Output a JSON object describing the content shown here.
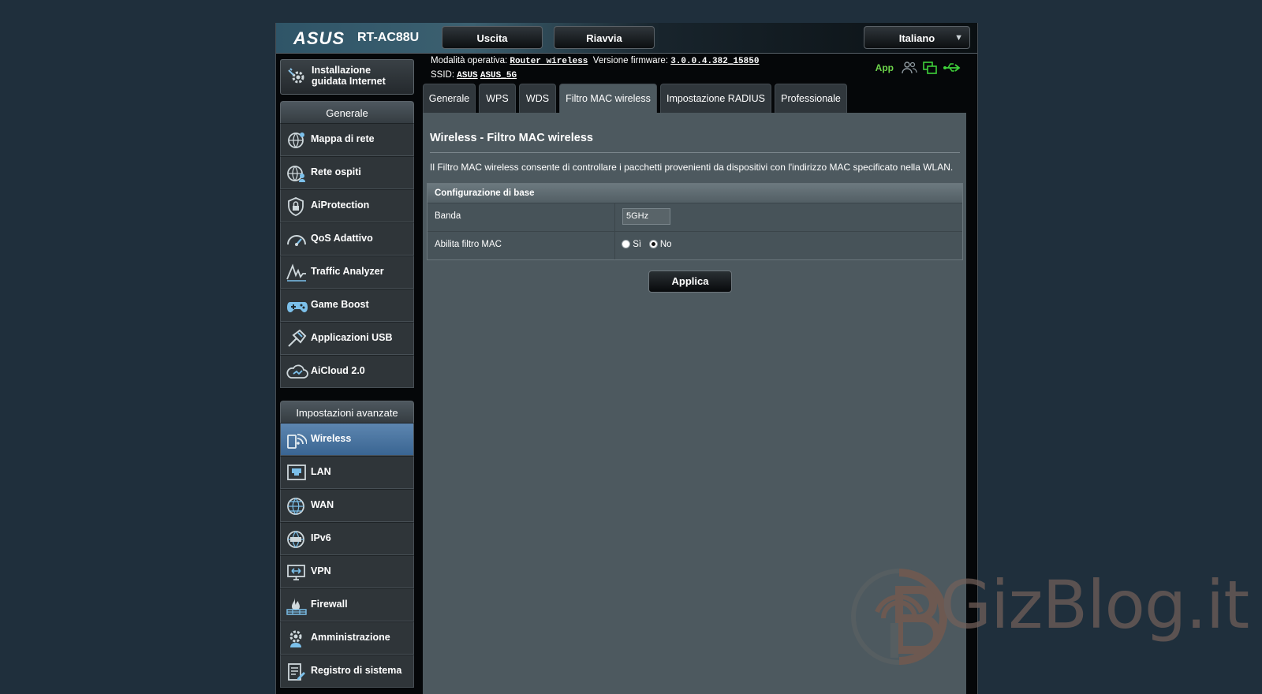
{
  "header": {
    "logo": "ASUS",
    "model": "RT-AC88U",
    "buttons": {
      "logout": "Uscita",
      "reboot": "Riavvia"
    },
    "language": "Italiano"
  },
  "info": {
    "mode_label": "Modalità operativa:",
    "mode_value": "Router wireless",
    "firmware_label": "Versione firmware:",
    "firmware_value": "3.0.0.4.382_15850",
    "ssid_label": "SSID:",
    "ssid_values": [
      "ASUS",
      "ASUS_5G"
    ],
    "app_label": "App"
  },
  "sidebar": {
    "qis_label_line1": "Installazione",
    "qis_label_line2": "guidata Internet",
    "general_header": "Generale",
    "general_items": [
      {
        "label": "Mappa di rete",
        "icon": "network-map-icon"
      },
      {
        "label": "Rete ospiti",
        "icon": "guest-network-icon"
      },
      {
        "label": "AiProtection",
        "icon": "shield-lock-icon"
      },
      {
        "label": "QoS Adattivo",
        "icon": "speedometer-icon"
      },
      {
        "label": "Traffic Analyzer",
        "icon": "traffic-analyzer-icon"
      },
      {
        "label": "Game Boost",
        "icon": "gamepad-icon"
      },
      {
        "label": "Applicazioni USB",
        "icon": "usb-app-icon"
      },
      {
        "label": "AiCloud 2.0",
        "icon": "cloud-icon"
      }
    ],
    "advanced_header": "Impostazioni avanzate",
    "advanced_items": [
      {
        "label": "Wireless",
        "icon": "wireless-icon",
        "active": true
      },
      {
        "label": "LAN",
        "icon": "lan-icon"
      },
      {
        "label": "WAN",
        "icon": "globe-icon"
      },
      {
        "label": "IPv6",
        "icon": "ipv6-icon"
      },
      {
        "label": "VPN",
        "icon": "vpn-icon"
      },
      {
        "label": "Firewall",
        "icon": "firewall-icon"
      },
      {
        "label": "Amministrazione",
        "icon": "admin-gear-icon"
      },
      {
        "label": "Registro di sistema",
        "icon": "system-log-icon"
      }
    ]
  },
  "tabs": [
    {
      "label": "Generale"
    },
    {
      "label": "WPS"
    },
    {
      "label": "WDS"
    },
    {
      "label": "Filtro MAC wireless",
      "active": true
    },
    {
      "label": "Impostazione RADIUS"
    },
    {
      "label": "Professionale"
    }
  ],
  "main": {
    "title": "Wireless - Filtro MAC wireless",
    "description": "Il Filtro MAC wireless consente di controllare i pacchetti provenienti da dispositivi con l'indirizzo MAC specificato nella WLAN.",
    "table_header": "Configurazione di base",
    "band_label": "Banda",
    "band_value": "5GHz",
    "mac_filter_label": "Abilita filtro MAC",
    "radio_yes": "Sì",
    "radio_no": "No",
    "radio_selected": "No",
    "apply_label": "Applica"
  },
  "watermark": {
    "text": "GizBlog.it"
  },
  "colors": {
    "accent_active": "#3f6c9a",
    "status_green": "#6dd44b",
    "background": "#1f2f3c",
    "content_bg": "#4d595f"
  }
}
